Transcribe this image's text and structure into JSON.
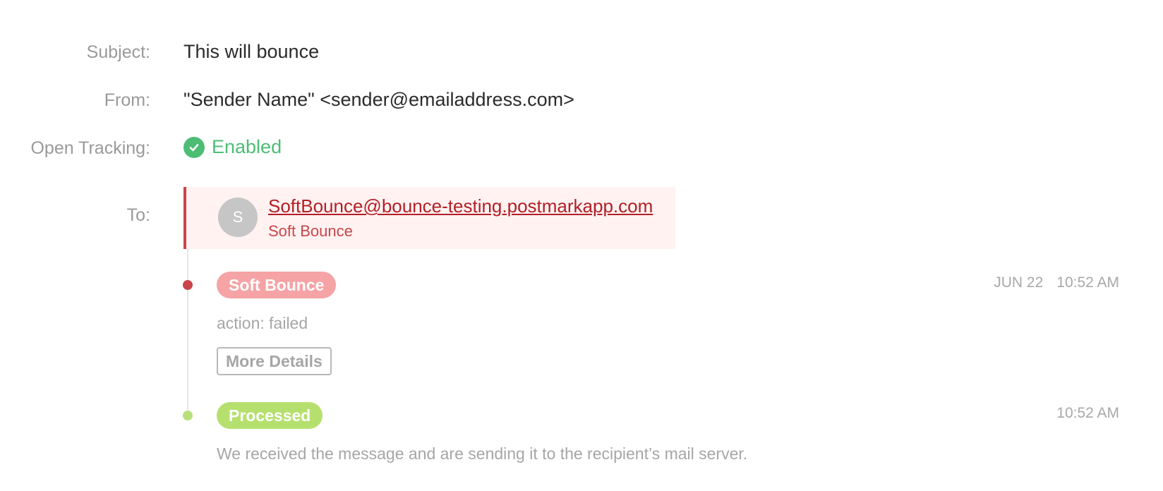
{
  "message": {
    "subject_label": "Subject:",
    "subject": "This will bounce",
    "from_label": "From:",
    "from": "\"Sender Name\" <sender@emailaddress.com>",
    "tracking_label": "Open Tracking:",
    "tracking_status": "Enabled",
    "tracking_icon": "check-circle-icon",
    "to_label": "To:"
  },
  "recipient": {
    "avatar_initial": "S",
    "email": "SoftBounce@bounce-testing.postmarkapp.com",
    "status": "Soft Bounce"
  },
  "events": [
    {
      "badge": "Soft Bounce",
      "date": "JUN 22",
      "time": "10:52 AM",
      "description": "action: failed",
      "button_label": "More Details",
      "color": "#f5a3a5",
      "dot_color": "#c9454a"
    },
    {
      "badge": "Processed",
      "date": "",
      "time": "10:52 AM",
      "description": "We received the message and are sending it to the recipient’s mail server.",
      "color": "#b5e06e",
      "dot_color": "#b8e07a"
    }
  ],
  "colors": {
    "enabled_green": "#4dbd74",
    "bounce_red": "#b21f26",
    "recipient_bg": "#fff2f1"
  }
}
